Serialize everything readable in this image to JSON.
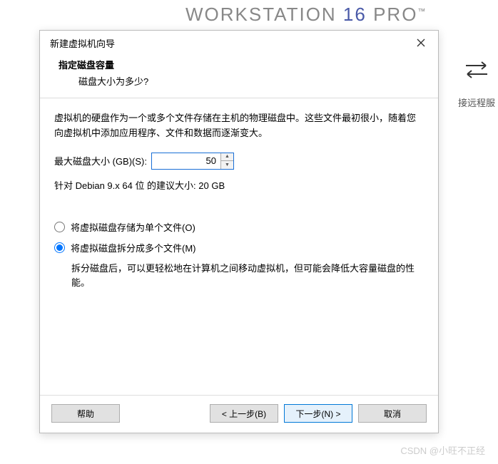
{
  "background": {
    "title_part1": "WORKSTATION ",
    "title_part2": "16 ",
    "title_part3": "PRO",
    "tm": "™",
    "side_label": "接远程服"
  },
  "dialog": {
    "title": "新建虚拟机向导",
    "header": {
      "title": "指定磁盘容量",
      "subtitle": "磁盘大小为多少?"
    },
    "intro": "虚拟机的硬盘作为一个或多个文件存储在主机的物理磁盘中。这些文件最初很小，随着您向虚拟机中添加应用程序、文件和数据而逐渐变大。",
    "disk_label": "最大磁盘大小 (GB)(S):",
    "disk_value": "50",
    "recommend": "针对 Debian 9.x 64 位 的建议大小: 20 GB",
    "radio_single": "将虚拟磁盘存储为单个文件(O)",
    "radio_multi": "将虚拟磁盘拆分成多个文件(M)",
    "radio_multi_desc": "拆分磁盘后，可以更轻松地在计算机之间移动虚拟机，但可能会降低大容量磁盘的性能。",
    "buttons": {
      "help": "帮助",
      "back": "< 上一步(B)",
      "next": "下一步(N) >",
      "cancel": "取消"
    }
  },
  "watermark": "CSDN @小旺不正经"
}
